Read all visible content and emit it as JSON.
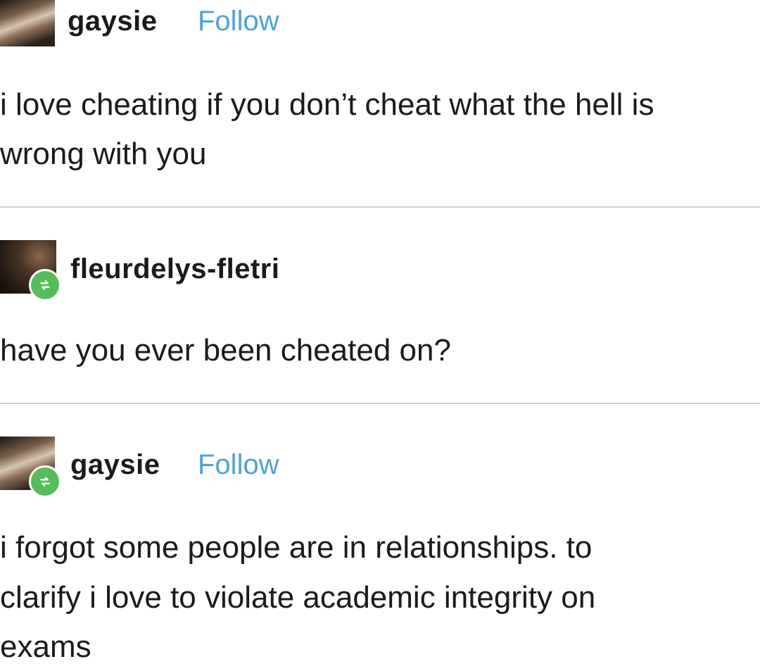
{
  "posts": [
    {
      "username": "gaysie",
      "follow_label": "Follow",
      "lines": [
        "i love cheating if you don’t cheat what the hell is",
        "wrong with you"
      ],
      "reblog_badge": false
    },
    {
      "username": "fleurdelys-fletri",
      "follow_label": "",
      "lines": [
        "have you ever been cheated on?"
      ],
      "reblog_badge": true
    },
    {
      "username": "gaysie",
      "follow_label": "Follow",
      "lines": [
        "i forgot some people are in relationships. to",
        "clarify i love to violate academic integrity on",
        "exams"
      ],
      "reblog_badge": true
    }
  ],
  "icons": {
    "reblog": "reblog-icon",
    "avatar": "avatar"
  },
  "colors": {
    "follow": "#4ea3d8",
    "reblog_badge": "#56bd5b",
    "divider": "#d3d3d3",
    "text": "#1a1a1a"
  }
}
